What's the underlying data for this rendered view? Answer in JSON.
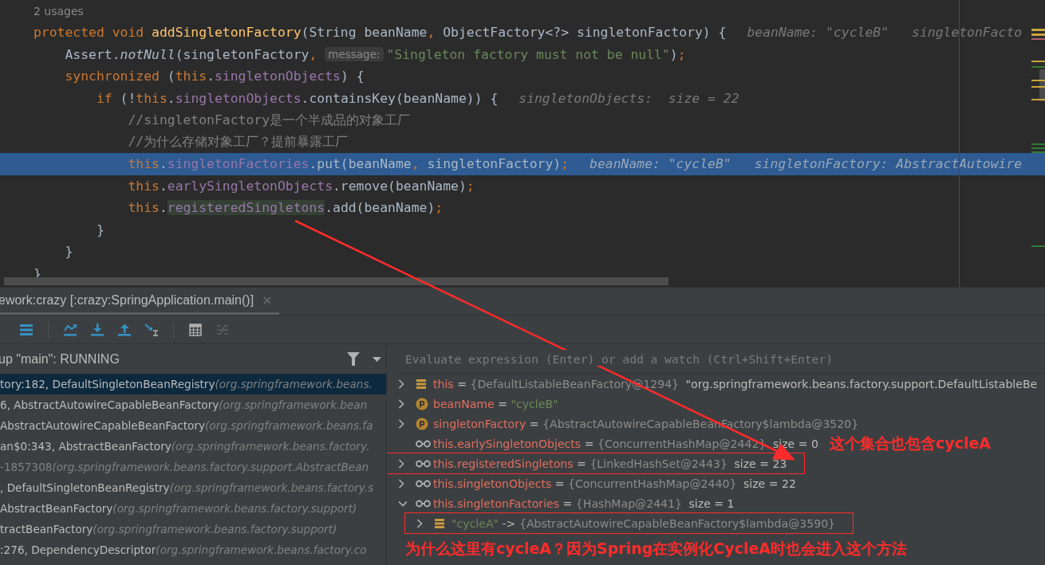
{
  "editor": {
    "usages": "2 usages",
    "lines": [
      {
        "execution_point": false,
        "segments": [
          {
            "kind": "code",
            "tokens": [
              {
                "t": "protected void ",
                "kind": "keyword"
              },
              {
                "t": "addSingletonFactory",
                "kind": "function"
              },
              {
                "t": "(String beanName",
                "kind": "plain"
              },
              {
                "t": ",",
                "kind": "keyword"
              },
              {
                "t": " ObjectFactory<?> singletonFactory) {",
                "kind": "plain"
              }
            ]
          },
          {
            "kind": "hint",
            "text": "beanName: \"cycleB\""
          },
          {
            "kind": "hint",
            "text": "singletonFacto"
          }
        ]
      },
      {
        "execution_point": false,
        "segments": [
          {
            "kind": "code",
            "tokens": [
              {
                "t": "    Assert.",
                "kind": "plain"
              },
              {
                "t": "notNull",
                "kind": "italic"
              },
              {
                "t": "(singletonFactory",
                "kind": "plain"
              },
              {
                "t": ",",
                "kind": "keyword"
              }
            ]
          },
          {
            "kind": "param",
            "text": "message:"
          },
          {
            "kind": "code",
            "tokens": [
              {
                "t": "\"Singleton factory must not be null\"",
                "kind": "string"
              },
              {
                "t": ")",
                "kind": "plain"
              },
              {
                "t": ";",
                "kind": "keyword"
              }
            ]
          }
        ]
      },
      {
        "execution_point": false,
        "segments": [
          {
            "kind": "code",
            "tokens": [
              {
                "t": "    synchronized ",
                "kind": "keyword"
              },
              {
                "t": "(",
                "kind": "plain"
              },
              {
                "t": "this",
                "kind": "keyword"
              },
              {
                "t": ".",
                "kind": "plain"
              },
              {
                "t": "singletonObjects",
                "kind": "field",
                "highlight": false
              },
              {
                "t": ") {",
                "kind": "plain"
              }
            ]
          }
        ]
      },
      {
        "execution_point": false,
        "segments": [
          {
            "kind": "code",
            "tokens": [
              {
                "t": "        if ",
                "kind": "keyword"
              },
              {
                "t": "(!",
                "kind": "plain"
              },
              {
                "t": "this",
                "kind": "keyword"
              },
              {
                "t": ".",
                "kind": "plain"
              },
              {
                "t": "singletonObjects",
                "kind": "field",
                "highlight": false
              },
              {
                "t": ".containsKey(beanName)) {",
                "kind": "plain"
              }
            ]
          },
          {
            "kind": "hint",
            "text": "singletonObjects:  size = 22"
          }
        ]
      },
      {
        "execution_point": false,
        "segments": [
          {
            "kind": "code",
            "tokens": [
              {
                "t": "            //singletonFactory是一个半成品的对象工厂",
                "kind": "comment"
              }
            ]
          }
        ]
      },
      {
        "execution_point": false,
        "segments": [
          {
            "kind": "code",
            "tokens": [
              {
                "t": "            //为什么存储对象工厂？提前暴露工厂",
                "kind": "comment"
              }
            ]
          }
        ]
      },
      {
        "execution_point": true,
        "segments": [
          {
            "kind": "code",
            "tokens": [
              {
                "t": "            this",
                "kind": "keyword"
              },
              {
                "t": ".",
                "kind": "plain"
              },
              {
                "t": "singletonFactories",
                "kind": "field",
                "highlight": false
              },
              {
                "t": ".put(beanName",
                "kind": "plain"
              },
              {
                "t": ",",
                "kind": "keyword"
              },
              {
                "t": " singletonFactory)",
                "kind": "plain"
              },
              {
                "t": ";",
                "kind": "keyword"
              }
            ]
          },
          {
            "kind": "hint",
            "text": "beanName: \"cycleB\""
          },
          {
            "kind": "hint",
            "text": "singletonFactory: AbstractAutowire"
          }
        ]
      },
      {
        "execution_point": false,
        "segments": [
          {
            "kind": "code",
            "tokens": [
              {
                "t": "            this",
                "kind": "keyword"
              },
              {
                "t": ".",
                "kind": "plain"
              },
              {
                "t": "earlySingletonObjects",
                "kind": "field",
                "highlight": false
              },
              {
                "t": ".remove(beanName)",
                "kind": "plain"
              },
              {
                "t": ";",
                "kind": "keyword"
              }
            ]
          }
        ]
      },
      {
        "execution_point": false,
        "segments": [
          {
            "kind": "code",
            "tokens": [
              {
                "t": "            this",
                "kind": "keyword"
              },
              {
                "t": ".",
                "kind": "plain"
              },
              {
                "t": "registeredSingletons",
                "kind": "field",
                "highlight": true
              },
              {
                "t": ".add(beanName)",
                "kind": "plain"
              },
              {
                "t": ";",
                "kind": "keyword"
              }
            ]
          }
        ]
      },
      {
        "execution_point": false,
        "segments": [
          {
            "kind": "code",
            "tokens": [
              {
                "t": "        }",
                "kind": "plain"
              }
            ]
          }
        ]
      },
      {
        "execution_point": false,
        "segments": [
          {
            "kind": "code",
            "tokens": [
              {
                "t": "    }",
                "kind": "plain"
              }
            ]
          }
        ]
      },
      {
        "execution_point": false,
        "segments": [
          {
            "kind": "code",
            "tokens": [
              {
                "t": "}",
                "kind": "plain"
              }
            ]
          }
        ]
      }
    ]
  },
  "debugger": {
    "tab": {
      "title": "ework:crazy [:crazy:SpringApplication.main()]",
      "selected": true
    },
    "toolbar": [
      {
        "kind": "menu",
        "disabled": false
      },
      {
        "kind": "separator"
      },
      {
        "kind": "step-over",
        "disabled": false
      },
      {
        "kind": "step-into",
        "disabled": false
      },
      {
        "kind": "step-out",
        "disabled": false
      },
      {
        "kind": "run-to-cursor",
        "disabled": false
      },
      {
        "kind": "separator"
      },
      {
        "kind": "evaluate",
        "disabled": false
      },
      {
        "kind": "trace",
        "disabled": true
      }
    ],
    "frames": {
      "header": "up \"main\": RUNNING",
      "items": [
        {
          "method": "tory:182, DefaultSingletonBeanRegistry",
          "package": "(org.springframework.beans.",
          "selected": true,
          "greyed": false
        },
        {
          "method": "6, AbstractAutowireCapableBeanFactory",
          "package": "(org.springframework.bean",
          "selected": false,
          "greyed": false
        },
        {
          "method": "AbstractAutowireCapableBeanFactory",
          "package": "(org.springframework.beans.fa",
          "selected": false,
          "greyed": false
        },
        {
          "method": "an$0:343, AbstractBeanFactory",
          "package": "(org.springframework.beans.factory.",
          "selected": false,
          "greyed": false
        },
        {
          "method": "-1857308",
          "package": "(org.springframework.beans.factory.support.AbstractBean",
          "selected": false,
          "greyed": true
        },
        {
          "method": ", DefaultSingletonBeanRegistry",
          "package": "(org.springframework.beans.factory.s",
          "selected": false,
          "greyed": false
        },
        {
          "method": "AbstractBeanFactory",
          "package": "(org.springframework.beans.factory.support)",
          "selected": false,
          "greyed": false
        },
        {
          "method": "tractBeanFactory",
          "package": "(org.springframework.beans.factory.support)",
          "selected": false,
          "greyed": false
        },
        {
          "method": ":276, DependencyDescriptor",
          "package": "(org.springframework.beans.factory.co",
          "selected": false,
          "greyed": false
        }
      ]
    },
    "watch": {
      "placeholder": "Evaluate expression (Enter) or add a watch (Ctrl+Shift+Enter)"
    },
    "variables": [
      {
        "kind": "field",
        "expanded": false,
        "boxed": false,
        "name": "this",
        "name_is_string": false,
        "separator": "=",
        "value": "{DefaultListableBeanFactory@1294}",
        "value_is_string": false,
        "detail": "\"org.springframework.beans.factory.support.DefaultListableBe"
      },
      {
        "kind": "param",
        "expanded": false,
        "boxed": false,
        "name": "beanName",
        "name_is_string": false,
        "separator": "=",
        "value": "\"cycleB\"",
        "value_is_string": true
      },
      {
        "kind": "param",
        "expanded": false,
        "boxed": false,
        "name": "singletonFactory",
        "name_is_string": false,
        "separator": "=",
        "value": "{AbstractAutowireCapableBeanFactory$lambda@3520}",
        "value_is_string": false
      },
      {
        "kind": "watch",
        "boxed": false,
        "name": "this.earlySingletonObjects",
        "name_is_string": false,
        "separator": "=",
        "value": "{ConcurrentHashMap@2442}",
        "value_is_string": false,
        "detail": "size = 0"
      },
      {
        "kind": "watch",
        "expanded": false,
        "boxed": true,
        "name": "this.registeredSingletons",
        "name_is_string": false,
        "separator": "=",
        "value": "{LinkedHashSet@2443}",
        "value_is_string": false,
        "detail": "size = 23"
      },
      {
        "kind": "watch",
        "expanded": false,
        "boxed": false,
        "name": "this.singletonObjects",
        "name_is_string": false,
        "separator": "=",
        "value": "{ConcurrentHashMap@2440}",
        "value_is_string": false,
        "detail": "size = 22"
      },
      {
        "kind": "watch",
        "expanded": true,
        "boxed": false,
        "name": "this.singletonFactories",
        "name_is_string": false,
        "separator": "=",
        "value": "{HashMap@2441}",
        "value_is_string": false,
        "detail": "size = 1",
        "children": [
          {
            "kind": "field",
            "expanded": false,
            "boxed": true,
            "name": "\"cycleA\"",
            "name_is_string": true,
            "separator": "->",
            "value": "{AbstractAutowireCapableBeanFactory$lambda@3590}",
            "value_is_string": false
          }
        ]
      }
    ]
  },
  "annotations": {
    "notes": [
      "这个集合也包含cycleA",
      "为什么这里有cycleA？因为Spring在实例化CycleA时也会进入这个方法"
    ]
  }
}
